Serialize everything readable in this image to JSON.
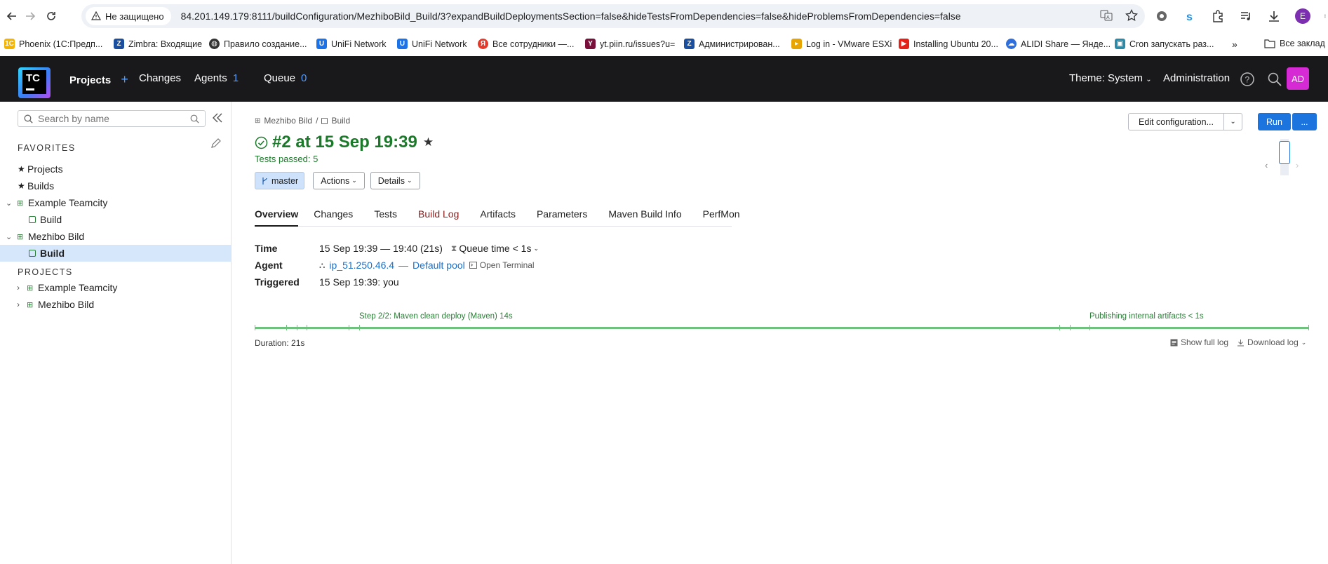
{
  "browser": {
    "security_label": "Не защищено",
    "url": "84.201.149.179:8111/buildConfiguration/MezhiboBild_Build/3?expandBuildDeploymentsSection=false&hideTestsFromDependencies=false&hideProblemsFromDependencies=false",
    "profile_initial": "E"
  },
  "bookmarks": [
    {
      "label": "Phoenix (1С:Предп...",
      "icon": "1c-icon",
      "color": "#f5b400"
    },
    {
      "label": "Zimbra: Входящие",
      "icon": "zimbra-icon",
      "color": "#1a4fa0"
    },
    {
      "label": "Правило создание...",
      "icon": "globe-icon",
      "color": "#333333"
    },
    {
      "label": "UniFi Network",
      "icon": "unifi-icon",
      "color": "#1a73e8"
    },
    {
      "label": "UniFi Network",
      "icon": "unifi-icon",
      "color": "#1a73e8"
    },
    {
      "label": "Все сотрудники —...",
      "icon": "yandex-icon",
      "color": "#e33a2b"
    },
    {
      "label": "yt.piin.ru/issues?u=",
      "icon": "youtrack-icon",
      "color": "#7a0f3c"
    },
    {
      "label": "Администрирован...",
      "icon": "zimbra-icon",
      "color": "#1a4fa0"
    },
    {
      "label": "Log in - VMware ESXi",
      "icon": "vmware-icon",
      "color": "#e8a400"
    },
    {
      "label": "Installing Ubuntu 20...",
      "icon": "youtube-icon",
      "color": "#e62117"
    },
    {
      "label": "ALIDI Share — Янде...",
      "icon": "cloud-icon",
      "color": "#2e6fdc"
    },
    {
      "label": "Cron запускать раз...",
      "icon": "site-icon",
      "color": "#2b8aa8"
    }
  ],
  "bookmarks_all": "Все заклад",
  "header": {
    "projects": "Projects",
    "changes": "Changes",
    "agents": "Agents",
    "agents_count": "1",
    "queue": "Queue",
    "queue_count": "0",
    "theme": "Theme: System",
    "administration": "Administration",
    "avatar": "AD",
    "logo_text": "TC"
  },
  "sidebar": {
    "search_placeholder": "Search by name",
    "favorites_heading": "FAVORITES",
    "favorites": [
      {
        "label": "Projects"
      },
      {
        "label": "Builds"
      }
    ],
    "fav_tree": [
      {
        "label": "Example Teamcity",
        "level": 0
      },
      {
        "label": "Build",
        "level": 1
      },
      {
        "label": "Mezhibo Bild",
        "level": 0
      },
      {
        "label": "Build",
        "level": 1,
        "selected": true
      }
    ],
    "projects_heading": "PROJECTS",
    "projects": [
      {
        "label": "Example Teamcity"
      },
      {
        "label": "Mezhibo Bild"
      }
    ]
  },
  "breadcrumb": {
    "project": "Mezhibo Bild",
    "separator": "/",
    "config": "Build"
  },
  "build": {
    "title": "#2 at 15 Sep 19:39",
    "status": "Tests passed: 5",
    "branch": "master",
    "actions": "Actions",
    "details": "Details"
  },
  "toolbar": {
    "edit_configuration": "Edit configuration...",
    "run": "Run",
    "more": "..."
  },
  "tabs": [
    {
      "label": "Overview",
      "active": true
    },
    {
      "label": "Changes"
    },
    {
      "label": "Tests"
    },
    {
      "label": "Build Log"
    },
    {
      "label": "Artifacts"
    },
    {
      "label": "Parameters"
    },
    {
      "label": "Maven Build Info"
    },
    {
      "label": "PerfMon"
    }
  ],
  "details": {
    "time_label": "Time",
    "time_value": "15 Sep 19:39 — 19:40 (21s)",
    "queue_time": "Queue time < 1s",
    "agent_label": "Agent",
    "agent_name": "ip_51.250.46.4",
    "agent_dash": "—",
    "agent_pool": "Default pool",
    "open_terminal": "Open Terminal",
    "triggered_label": "Triggered",
    "triggered_value": "15 Sep 19:39: you"
  },
  "timeline": {
    "step_label": "Step 2/2: Maven clean deploy (Maven) 14s",
    "publish_label": "Publishing internal artifacts < 1s",
    "color": "#6fc27d"
  },
  "duration": "Duration: 21s",
  "log_links": {
    "show_full_log": "Show full log",
    "download_log": "Download log"
  }
}
